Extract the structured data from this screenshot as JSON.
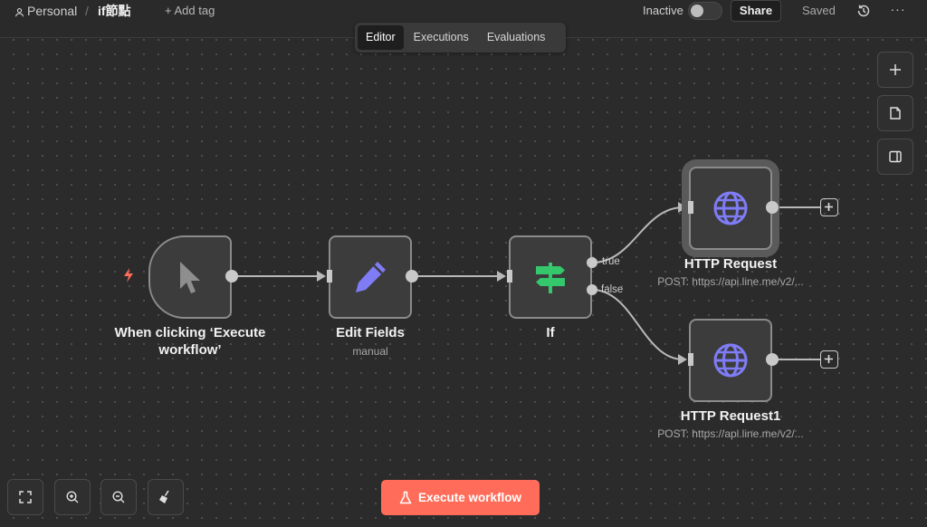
{
  "header": {
    "workspace": "Personal",
    "separator": "/",
    "workflow_name": "if節點",
    "add_tag": "+ Add tag",
    "status_label": "Inactive",
    "share_label": "Share",
    "saved_label": "Saved",
    "more_label": "···"
  },
  "tabs": [
    {
      "label": "Editor",
      "active": true
    },
    {
      "label": "Executions",
      "active": false
    },
    {
      "label": "Evaluations",
      "active": false
    }
  ],
  "nodes": {
    "trigger": {
      "title_line1": "When clicking ‘Execute",
      "title_line2": "workflow’",
      "icon": "cursor-icon"
    },
    "edit_fields": {
      "title": "Edit Fields",
      "subtitle": "manual",
      "icon": "pencil-icon"
    },
    "if": {
      "title": "If",
      "icon": "signpost-icon",
      "true_label": "true",
      "false_label": "false"
    },
    "http1": {
      "title": "HTTP Request",
      "subtitle": "POST: https://api.line.me/v2/...",
      "icon": "globe-icon"
    },
    "http2": {
      "title": "HTTP Request1",
      "subtitle": "POST: https://api.line.me/v2/...",
      "icon": "globe-icon"
    }
  },
  "controls": {
    "execute_label": "Execute workflow"
  },
  "colors": {
    "accent": "#ff6d5a",
    "node_icon_purple": "#7f7cf6",
    "if_icon_green": "#35c76c",
    "trigger_bolt": "#ff6d5a"
  }
}
